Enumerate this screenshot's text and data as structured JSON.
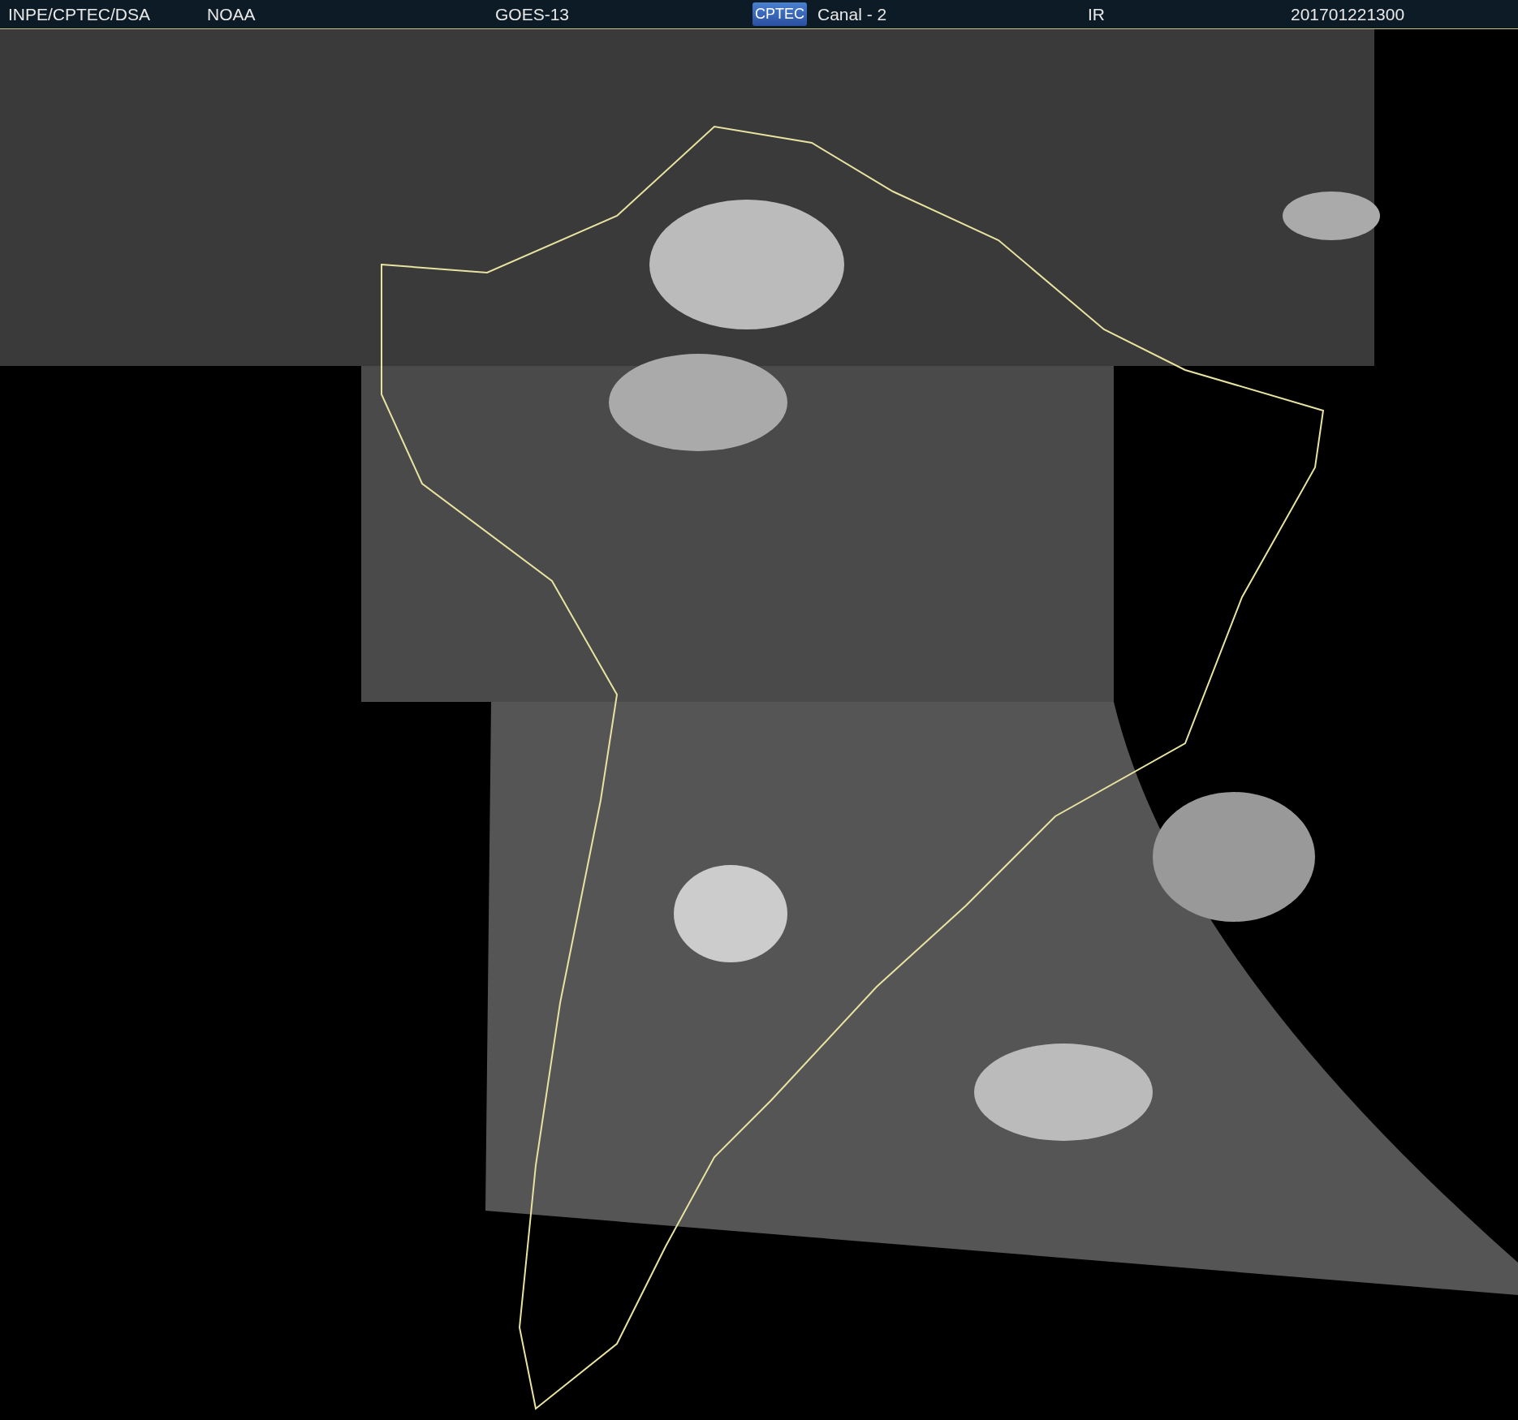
{
  "header": {
    "items": [
      {
        "kind": "text",
        "text": "INPE/CPTEC/DSA"
      },
      {
        "kind": "text",
        "text": "NOAA"
      },
      {
        "kind": "text",
        "text": "GOES-13"
      },
      {
        "kind": "logo",
        "text": "CPTEC"
      },
      {
        "kind": "text",
        "text": "Canal - 2"
      },
      {
        "kind": "text",
        "text": "IR"
      },
      {
        "kind": "text",
        "text": "201701221300"
      }
    ]
  }
}
